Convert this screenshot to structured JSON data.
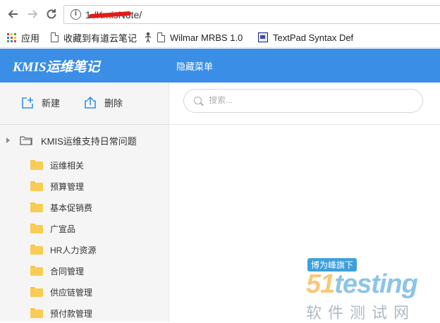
{
  "browser": {
    "url": "1        /KmisNote/",
    "bookmarks": [
      "应用",
      "收藏到有道云笔记",
      "Wilmar MRBS 1.0",
      "TextPad Syntax Def"
    ]
  },
  "header": {
    "brand": "KMIS运维笔记",
    "hide_menu": "隐藏菜单"
  },
  "toolbar": {
    "new_label": "新建",
    "delete_label": "删除"
  },
  "tree": {
    "root": "KMIS运维支持日常问题",
    "items": [
      "运维相关",
      "预算管理",
      "基本促销费",
      "广宣品",
      "HR人力资源",
      "合同管理",
      "供应链管理",
      "预付款管理"
    ]
  },
  "search": {
    "placeholder": "搜索..."
  },
  "watermark": {
    "tag": "博为峰旗下",
    "logo_a": "51",
    "logo_b": "testing",
    "sub": "软件测试网"
  },
  "colors": {
    "header_bg": "#3a8ee6",
    "folder": "#f9cc55"
  }
}
